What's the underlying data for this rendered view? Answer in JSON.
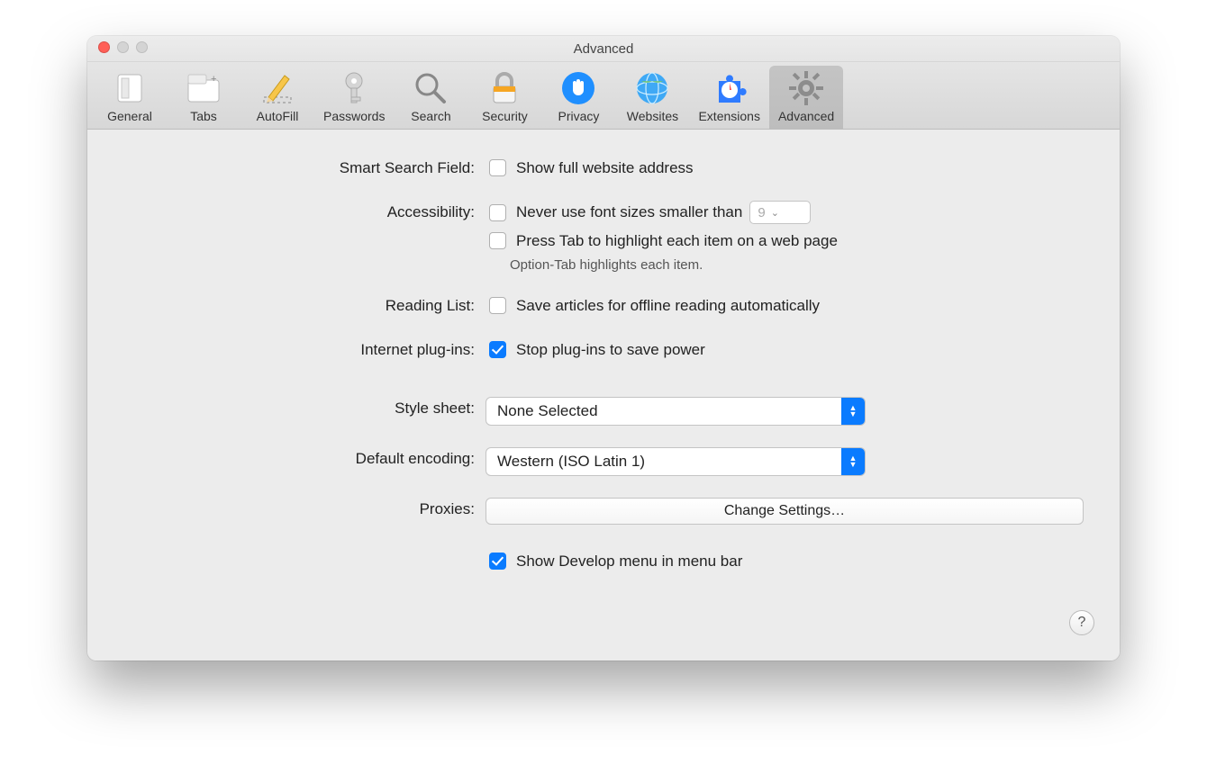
{
  "window": {
    "title": "Advanced"
  },
  "toolbar": {
    "items": [
      {
        "id": "general",
        "label": "General"
      },
      {
        "id": "tabs",
        "label": "Tabs"
      },
      {
        "id": "autofill",
        "label": "AutoFill"
      },
      {
        "id": "passwords",
        "label": "Passwords"
      },
      {
        "id": "search",
        "label": "Search"
      },
      {
        "id": "security",
        "label": "Security"
      },
      {
        "id": "privacy",
        "label": "Privacy"
      },
      {
        "id": "websites",
        "label": "Websites"
      },
      {
        "id": "extensions",
        "label": "Extensions"
      },
      {
        "id": "advanced",
        "label": "Advanced",
        "selected": true
      }
    ]
  },
  "sections": {
    "smart_search": {
      "label": "Smart Search Field:",
      "show_full_address": {
        "label": "Show full website address",
        "checked": false
      }
    },
    "accessibility": {
      "label": "Accessibility:",
      "min_font": {
        "label": "Never use font sizes smaller than",
        "checked": false,
        "value": "9"
      },
      "press_tab": {
        "label": "Press Tab to highlight each item on a web page",
        "checked": false
      },
      "hint": "Option-Tab highlights each item."
    },
    "reading_list": {
      "label": "Reading List:",
      "save_offline": {
        "label": "Save articles for offline reading automatically",
        "checked": false
      }
    },
    "plugins": {
      "label": "Internet plug-ins:",
      "stop_plugins": {
        "label": "Stop plug-ins to save power",
        "checked": true
      }
    },
    "stylesheet": {
      "label": "Style sheet:",
      "value": "None Selected"
    },
    "encoding": {
      "label": "Default encoding:",
      "value": "Western (ISO Latin 1)"
    },
    "proxies": {
      "label": "Proxies:",
      "button": "Change Settings…"
    },
    "develop": {
      "label": "Show Develop menu in menu bar",
      "checked": true
    }
  },
  "help_glyph": "?"
}
